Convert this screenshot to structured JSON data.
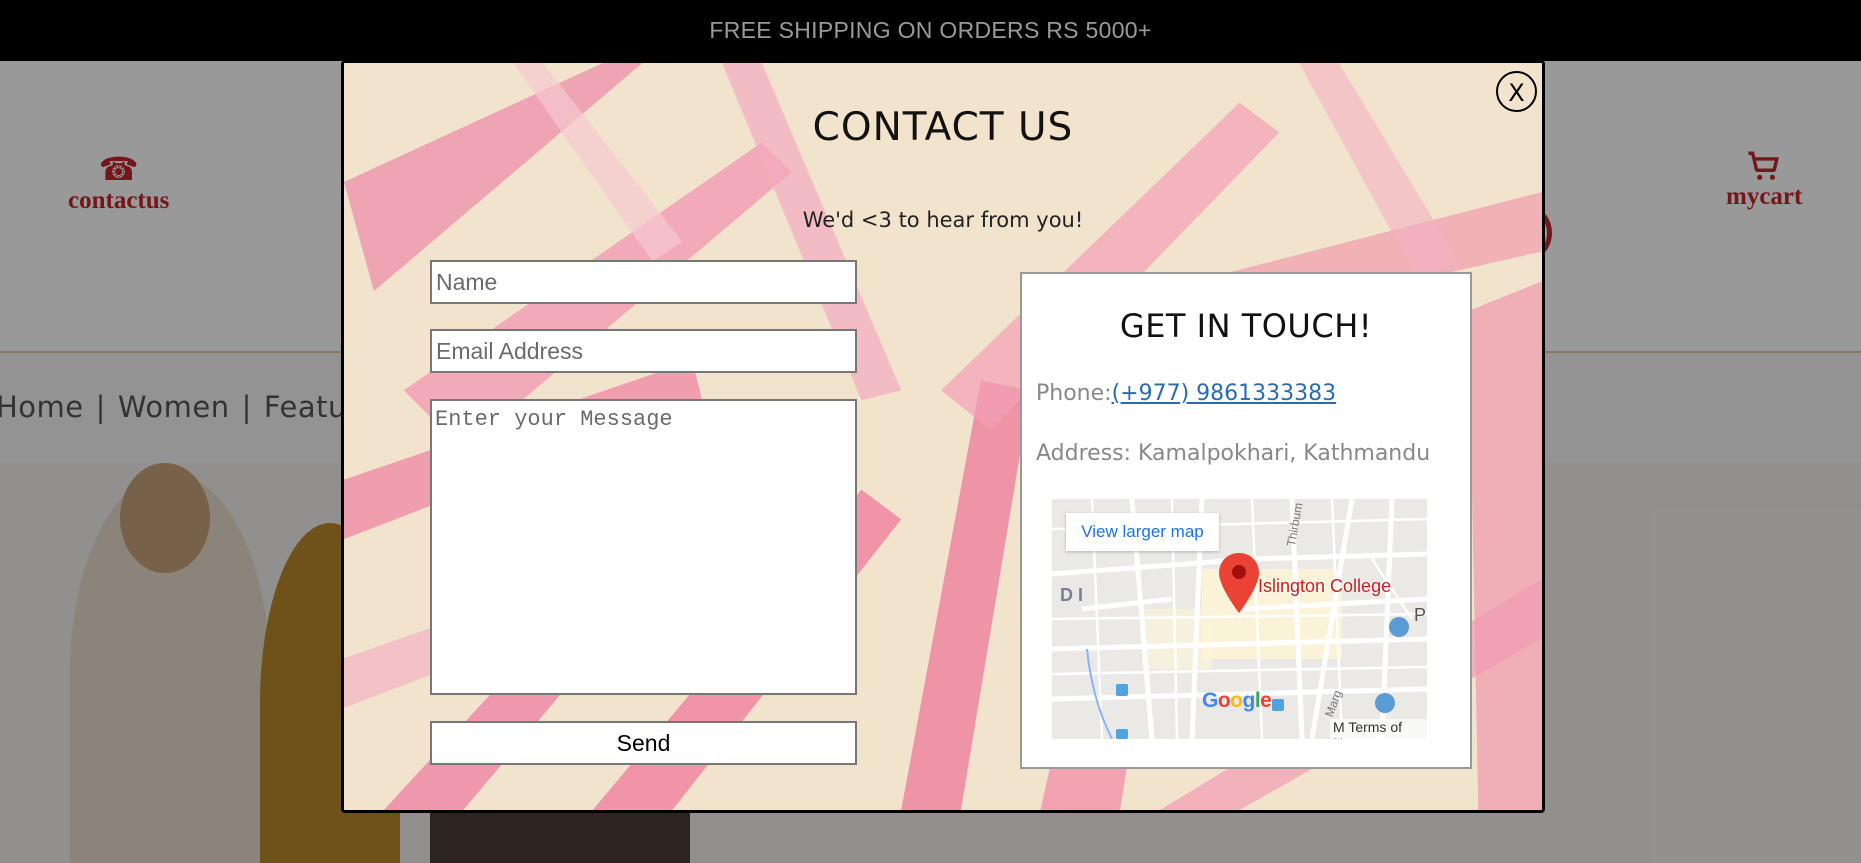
{
  "topbar": {
    "text": "FREE SHIPPING ON ORDERS RS 5000+"
  },
  "header": {
    "contact_label": "contactus",
    "cart_label": "mycart",
    "contact_icon": "phone-icon",
    "cart_icon": "cart-icon"
  },
  "breadcrumb": {
    "items": [
      "Home",
      "Women",
      "Featured"
    ],
    "separator": "|"
  },
  "modal": {
    "close_label": "X",
    "title": "CONTACT US",
    "subtitle": "We'd <3 to hear from you!",
    "form": {
      "name_placeholder": "Name",
      "email_placeholder": "Email Address",
      "message_placeholder": "Enter your Message",
      "send_label": "Send"
    },
    "touch": {
      "title": "GET IN TOUCH!",
      "phone_label": "Phone:",
      "phone_value": "(+977) 9861333383",
      "address_text": "Address: Kamalpokhari, Kathmandu"
    },
    "map": {
      "view_larger": "View larger map",
      "place": "Islington College",
      "terms": "Terms of Use",
      "street_1": "Thirbum Marg",
      "street_2": "Marg",
      "area_letters": "D I",
      "edge_letter": "P",
      "edge_letter_2": "M",
      "google_letters": [
        "G",
        "o",
        "o",
        "g",
        "l",
        "e"
      ],
      "google_colors": [
        "#4285F4",
        "#EA4335",
        "#FBBC05",
        "#4285F4",
        "#34A853",
        "#EA4335"
      ]
    }
  },
  "colors": {
    "accent": "#c1272d",
    "link": "#2b6cb0",
    "overlay": "rgba(0,0,0,0.4)"
  }
}
